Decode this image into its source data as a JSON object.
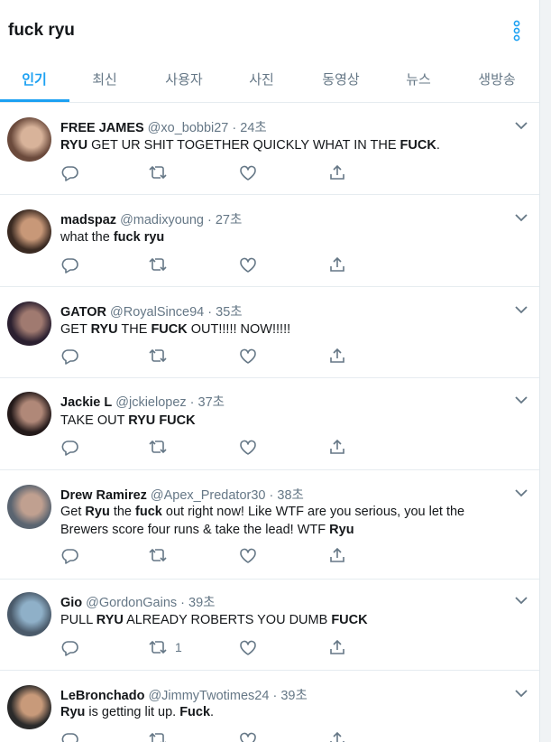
{
  "search": {
    "query": "fuck ryu"
  },
  "tabs": [
    {
      "label": "인기"
    },
    {
      "label": "최신"
    },
    {
      "label": "사용자"
    },
    {
      "label": "사진"
    },
    {
      "label": "동영상"
    },
    {
      "label": "뉴스"
    },
    {
      "label": "생방송"
    }
  ],
  "colors": {
    "accent": "#1da1f2",
    "secondary_text": "#657786",
    "divider": "#e6ecf0"
  },
  "icons": [
    "more-vertical-icon",
    "chevron-down-icon",
    "reply-icon",
    "retweet-icon",
    "like-icon",
    "share-icon"
  ],
  "tweets": [
    {
      "name": "FREE JAMES",
      "handle": "@xo_bobbi27",
      "sep": " · ",
      "time": "24초",
      "text_parts": [
        {
          "t": "RYU",
          "b": true
        },
        {
          "t": " GET UR SHIT TOGETHER QUICKLY WHAT IN THE ",
          "b": false
        },
        {
          "t": "FUCK",
          "b": true
        },
        {
          "t": ".",
          "b": false
        }
      ],
      "retweets": ""
    },
    {
      "name": "madspaz",
      "handle": "@madixyoung",
      "sep": " · ",
      "time": "27초",
      "text_parts": [
        {
          "t": "what the ",
          "b": false
        },
        {
          "t": "fuck",
          "b": true
        },
        {
          "t": " ",
          "b": false
        },
        {
          "t": "ryu",
          "b": true
        }
      ],
      "retweets": ""
    },
    {
      "name": "GATOR",
      "handle": "@RoyalSince94",
      "sep": " · ",
      "time": "35초",
      "text_parts": [
        {
          "t": "GET ",
          "b": false
        },
        {
          "t": "RYU",
          "b": true
        },
        {
          "t": " THE ",
          "b": false
        },
        {
          "t": "FUCK",
          "b": true
        },
        {
          "t": " OUT!!!!! NOW!!!!!",
          "b": false
        }
      ],
      "retweets": ""
    },
    {
      "name": "Jackie L",
      "handle": "@jckielopez",
      "sep": " · ",
      "time": "37초",
      "text_parts": [
        {
          "t": "TAKE OUT ",
          "b": false
        },
        {
          "t": "RYU",
          "b": true
        },
        {
          "t": " ",
          "b": false
        },
        {
          "t": "FUCK",
          "b": true
        }
      ],
      "retweets": ""
    },
    {
      "name": "Drew Ramirez",
      "handle": "@Apex_Predator30",
      "sep": " · ",
      "time": "38초",
      "text_parts": [
        {
          "t": "Get ",
          "b": false
        },
        {
          "t": "Ryu",
          "b": true
        },
        {
          "t": " the ",
          "b": false
        },
        {
          "t": "fuck",
          "b": true
        },
        {
          "t": " out right now! Like WTF are you serious, you let the Brewers score four runs & take the lead! WTF ",
          "b": false
        },
        {
          "t": "Ryu",
          "b": true
        }
      ],
      "retweets": ""
    },
    {
      "name": "Gio",
      "handle": "@GordonGains",
      "sep": " · ",
      "time": "39초",
      "text_parts": [
        {
          "t": "PULL ",
          "b": false
        },
        {
          "t": "RYU",
          "b": true
        },
        {
          "t": " ALREADY ROBERTS YOU DUMB ",
          "b": false
        },
        {
          "t": "FUCK",
          "b": true
        }
      ],
      "retweets": "1"
    },
    {
      "name": "LeBronchado",
      "handle": "@JimmyTwotimes24",
      "sep": " · ",
      "time": "39초",
      "text_parts": [
        {
          "t": "Ryu",
          "b": true
        },
        {
          "t": " is getting lit up. ",
          "b": false
        },
        {
          "t": "Fuck",
          "b": true
        },
        {
          "t": ".",
          "b": false
        }
      ],
      "retweets": ""
    }
  ]
}
